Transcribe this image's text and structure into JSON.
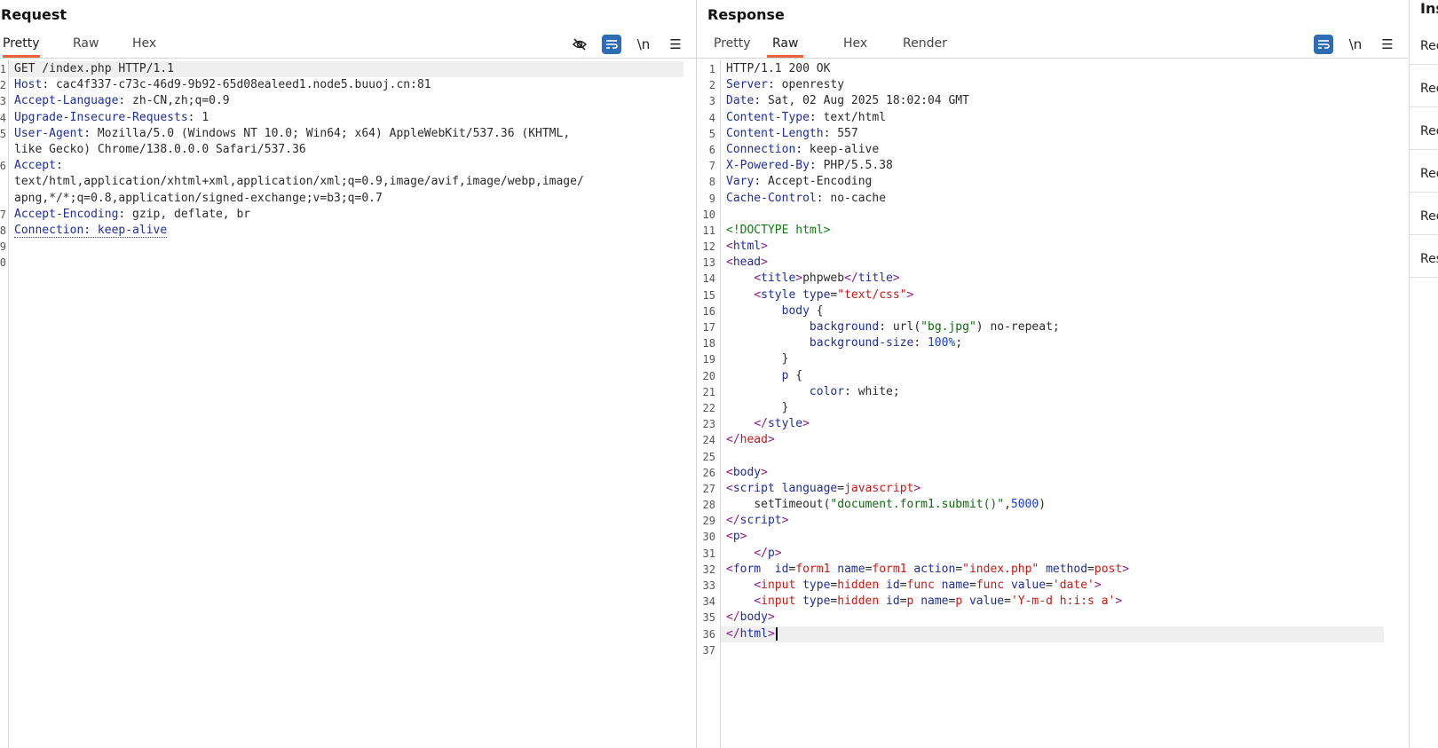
{
  "request": {
    "title": "Request",
    "tabs": [
      "Pretty",
      "Raw",
      "Hex"
    ],
    "active_tab": "Pretty",
    "tools": {
      "newline": "\\n"
    },
    "lines": [
      {
        "n": "1",
        "k": "GET /index.php HTTP/1.1",
        "v": ""
      },
      {
        "n": "2",
        "k": "Host",
        "v": ": cac4f337-c73c-46d9-9b92-65d08ealeed1.node5.buuoj.cn:81"
      },
      {
        "n": "3",
        "k": "Accept-Language",
        "v": ": zh-CN,zh;q=0.9"
      },
      {
        "n": "4",
        "k": "Upgrade-Insecure-Requests",
        "v": ": 1"
      },
      {
        "n": "5",
        "k": "User-Agent",
        "v": ": Mozilla/5.0 (Windows NT 10.0; Win64; x64) AppleWebKit/537.36 (KHTML,"
      },
      {
        "n": "",
        "k": "",
        "v": "like Gecko) Chrome/138.0.0.0 Safari/537.36"
      },
      {
        "n": "6",
        "k": "Accept",
        "v": ":"
      },
      {
        "n": "",
        "k": "",
        "v": "text/html,application/xhtml+xml,application/xml;q=0.9,image/avif,image/webp,image/"
      },
      {
        "n": "",
        "k": "",
        "v": "apng,*/*;q=0.8,application/signed-exchange;v=b3;q=0.7"
      },
      {
        "n": "7",
        "k": "Accept-Encoding",
        "v": ": gzip, deflate, br"
      },
      {
        "n": "8",
        "k": "Connection: keep-alive",
        "v": ""
      },
      {
        "n": "9",
        "k": "",
        "v": ""
      },
      {
        "n": "0",
        "k": "",
        "v": ""
      }
    ]
  },
  "response": {
    "title": "Response",
    "tabs": [
      "Pretty",
      "Raw",
      "Hex",
      "Render"
    ],
    "active_tab": "Raw",
    "tools": {
      "newline": "\\n"
    },
    "headers": [
      {
        "n": "1",
        "k": "HTTP/1.1 200 OK",
        "v": ""
      },
      {
        "n": "2",
        "k": "Server",
        "v": ": openresty"
      },
      {
        "n": "3",
        "k": "Date",
        "v": ": Sat, 02 Aug 2025 18:02:04 GMT"
      },
      {
        "n": "4",
        "k": "Content-Type",
        "v": ": text/html"
      },
      {
        "n": "5",
        "k": "Content-Length",
        "v": ": 557"
      },
      {
        "n": "6",
        "k": "Connection",
        "v": ": keep-alive"
      },
      {
        "n": "7",
        "k": "X-Powered-By",
        "v": ": PHP/5.5.38"
      },
      {
        "n": "8",
        "k": "Vary",
        "v": ": Accept-Encoding"
      },
      {
        "n": "9",
        "k": "Cache-Control",
        "v": ": no-cache"
      }
    ],
    "body_lines": [
      [
        {
          "c": "",
          "t": ""
        }
      ],
      [
        {
          "c": "dt",
          "t": "<!DOCTYPE html>"
        }
      ],
      [
        {
          "c": "tg",
          "t": "<"
        },
        {
          "c": "at",
          "t": "html"
        },
        {
          "c": "tg",
          "t": ">"
        }
      ],
      [
        {
          "c": "tg",
          "t": "<"
        },
        {
          "c": "at",
          "t": "head"
        },
        {
          "c": "tg",
          "t": ">"
        }
      ],
      [
        {
          "c": "",
          "t": "    "
        },
        {
          "c": "tg",
          "t": "<"
        },
        {
          "c": "at",
          "t": "title"
        },
        {
          "c": "tg",
          "t": ">"
        },
        {
          "c": "v",
          "t": "phpweb"
        },
        {
          "c": "tg",
          "t": "</"
        },
        {
          "c": "at",
          "t": "title"
        },
        {
          "c": "tg",
          "t": ">"
        }
      ],
      [
        {
          "c": "",
          "t": "    "
        },
        {
          "c": "tg",
          "t": "<"
        },
        {
          "c": "at",
          "t": "style"
        },
        {
          "c": "v",
          "t": " "
        },
        {
          "c": "at",
          "t": "type"
        },
        {
          "c": "v",
          "t": "="
        },
        {
          "c": "av",
          "t": "\"text/css\""
        },
        {
          "c": "tg",
          "t": ">"
        }
      ],
      [
        {
          "c": "",
          "t": "        "
        },
        {
          "c": "at",
          "t": "body"
        },
        {
          "c": "v",
          "t": " {"
        }
      ],
      [
        {
          "c": "",
          "t": "            "
        },
        {
          "c": "at",
          "t": "background"
        },
        {
          "c": "v",
          "t": ": url("
        },
        {
          "c": "st",
          "t": "\"bg.jpg\""
        },
        {
          "c": "v",
          "t": ") no-repeat;"
        }
      ],
      [
        {
          "c": "",
          "t": "            "
        },
        {
          "c": "at",
          "t": "background-size"
        },
        {
          "c": "v",
          "t": ": "
        },
        {
          "c": "nm",
          "t": "100%"
        },
        {
          "c": "v",
          "t": ";"
        }
      ],
      [
        {
          "c": "",
          "t": "        "
        },
        {
          "c": "v",
          "t": "}"
        }
      ],
      [
        {
          "c": "",
          "t": "        "
        },
        {
          "c": "at",
          "t": "p"
        },
        {
          "c": "v",
          "t": " {"
        }
      ],
      [
        {
          "c": "",
          "t": "            "
        },
        {
          "c": "at",
          "t": "color"
        },
        {
          "c": "v",
          "t": ": white;"
        }
      ],
      [
        {
          "c": "",
          "t": "        "
        },
        {
          "c": "v",
          "t": "}"
        }
      ],
      [
        {
          "c": "",
          "t": "    "
        },
        {
          "c": "tg",
          "t": "</"
        },
        {
          "c": "at",
          "t": "style"
        },
        {
          "c": "tg",
          "t": ">"
        }
      ],
      [
        {
          "c": "tg",
          "t": "</"
        },
        {
          "c": "av",
          "t": "head"
        },
        {
          "c": "tg",
          "t": ">"
        }
      ],
      [
        {
          "c": "",
          "t": ""
        }
      ],
      [
        {
          "c": "tg",
          "t": "<"
        },
        {
          "c": "at",
          "t": "body"
        },
        {
          "c": "tg",
          "t": ">"
        }
      ],
      [
        {
          "c": "tg",
          "t": "<"
        },
        {
          "c": "at",
          "t": "script"
        },
        {
          "c": "v",
          "t": " "
        },
        {
          "c": "at",
          "t": "language"
        },
        {
          "c": "v",
          "t": "="
        },
        {
          "c": "av",
          "t": "javascript"
        },
        {
          "c": "tg",
          "t": ">"
        }
      ],
      [
        {
          "c": "",
          "t": "    "
        },
        {
          "c": "v",
          "t": "setTimeout("
        },
        {
          "c": "st",
          "t": "\"document.form1.submit()\""
        },
        {
          "c": "v",
          "t": ","
        },
        {
          "c": "nm",
          "t": "5000"
        },
        {
          "c": "v",
          "t": ")"
        }
      ],
      [
        {
          "c": "tg",
          "t": "</"
        },
        {
          "c": "at",
          "t": "script"
        },
        {
          "c": "tg",
          "t": ">"
        }
      ],
      [
        {
          "c": "tg",
          "t": "<"
        },
        {
          "c": "at",
          "t": "p"
        },
        {
          "c": "tg",
          "t": ">"
        }
      ],
      [
        {
          "c": "",
          "t": "    "
        },
        {
          "c": "tg",
          "t": "</"
        },
        {
          "c": "at",
          "t": "p"
        },
        {
          "c": "tg",
          "t": ">"
        }
      ],
      [
        {
          "c": "tg",
          "t": "<"
        },
        {
          "c": "at",
          "t": "form"
        },
        {
          "c": "v",
          "t": "  "
        },
        {
          "c": "at",
          "t": "id"
        },
        {
          "c": "v",
          "t": "="
        },
        {
          "c": "av",
          "t": "form1"
        },
        {
          "c": "v",
          "t": " "
        },
        {
          "c": "at",
          "t": "name"
        },
        {
          "c": "v",
          "t": "="
        },
        {
          "c": "av",
          "t": "form1"
        },
        {
          "c": "v",
          "t": " "
        },
        {
          "c": "at",
          "t": "action"
        },
        {
          "c": "v",
          "t": "="
        },
        {
          "c": "av",
          "t": "\"index.php\""
        },
        {
          "c": "v",
          "t": " "
        },
        {
          "c": "at",
          "t": "method"
        },
        {
          "c": "v",
          "t": "="
        },
        {
          "c": "av",
          "t": "post"
        },
        {
          "c": "tg",
          "t": ">"
        }
      ],
      [
        {
          "c": "",
          "t": "    "
        },
        {
          "c": "tg",
          "t": "<"
        },
        {
          "c": "av",
          "t": "input"
        },
        {
          "c": "v",
          "t": " "
        },
        {
          "c": "at",
          "t": "type"
        },
        {
          "c": "v",
          "t": "="
        },
        {
          "c": "av",
          "t": "hidden"
        },
        {
          "c": "v",
          "t": " "
        },
        {
          "c": "at",
          "t": "id"
        },
        {
          "c": "v",
          "t": "="
        },
        {
          "c": "av",
          "t": "func"
        },
        {
          "c": "v",
          "t": " "
        },
        {
          "c": "at",
          "t": "name"
        },
        {
          "c": "v",
          "t": "="
        },
        {
          "c": "av",
          "t": "func"
        },
        {
          "c": "v",
          "t": " "
        },
        {
          "c": "at",
          "t": "value"
        },
        {
          "c": "v",
          "t": "="
        },
        {
          "c": "av",
          "t": "'date'"
        },
        {
          "c": "tg",
          "t": ">"
        }
      ],
      [
        {
          "c": "",
          "t": "    "
        },
        {
          "c": "tg",
          "t": "<"
        },
        {
          "c": "av",
          "t": "input"
        },
        {
          "c": "v",
          "t": " "
        },
        {
          "c": "at",
          "t": "type"
        },
        {
          "c": "v",
          "t": "="
        },
        {
          "c": "av",
          "t": "hidden"
        },
        {
          "c": "v",
          "t": " "
        },
        {
          "c": "at",
          "t": "id"
        },
        {
          "c": "v",
          "t": "="
        },
        {
          "c": "av",
          "t": "p"
        },
        {
          "c": "v",
          "t": " "
        },
        {
          "c": "at",
          "t": "name"
        },
        {
          "c": "v",
          "t": "="
        },
        {
          "c": "av",
          "t": "p"
        },
        {
          "c": "v",
          "t": " "
        },
        {
          "c": "at",
          "t": "value"
        },
        {
          "c": "v",
          "t": "="
        },
        {
          "c": "av",
          "t": "'Y-m-d h:i:s a'"
        },
        {
          "c": "tg",
          "t": ">"
        }
      ],
      [
        {
          "c": "tg",
          "t": "</"
        },
        {
          "c": "at",
          "t": "body"
        },
        {
          "c": "tg",
          "t": ">"
        }
      ],
      [
        {
          "c": "tg",
          "t": "</"
        },
        {
          "c": "at",
          "t": "html"
        },
        {
          "c": "tg",
          "t": ">"
        }
      ],
      [
        {
          "c": "",
          "t": ""
        }
      ]
    ]
  },
  "inspector": {
    "title": "Ins",
    "items": [
      "Req",
      "Req",
      "Req",
      "Req",
      "Req",
      "Res"
    ]
  },
  "colors": {
    "accent": "#e8643c",
    "toggle_on": "#2e6db4"
  }
}
